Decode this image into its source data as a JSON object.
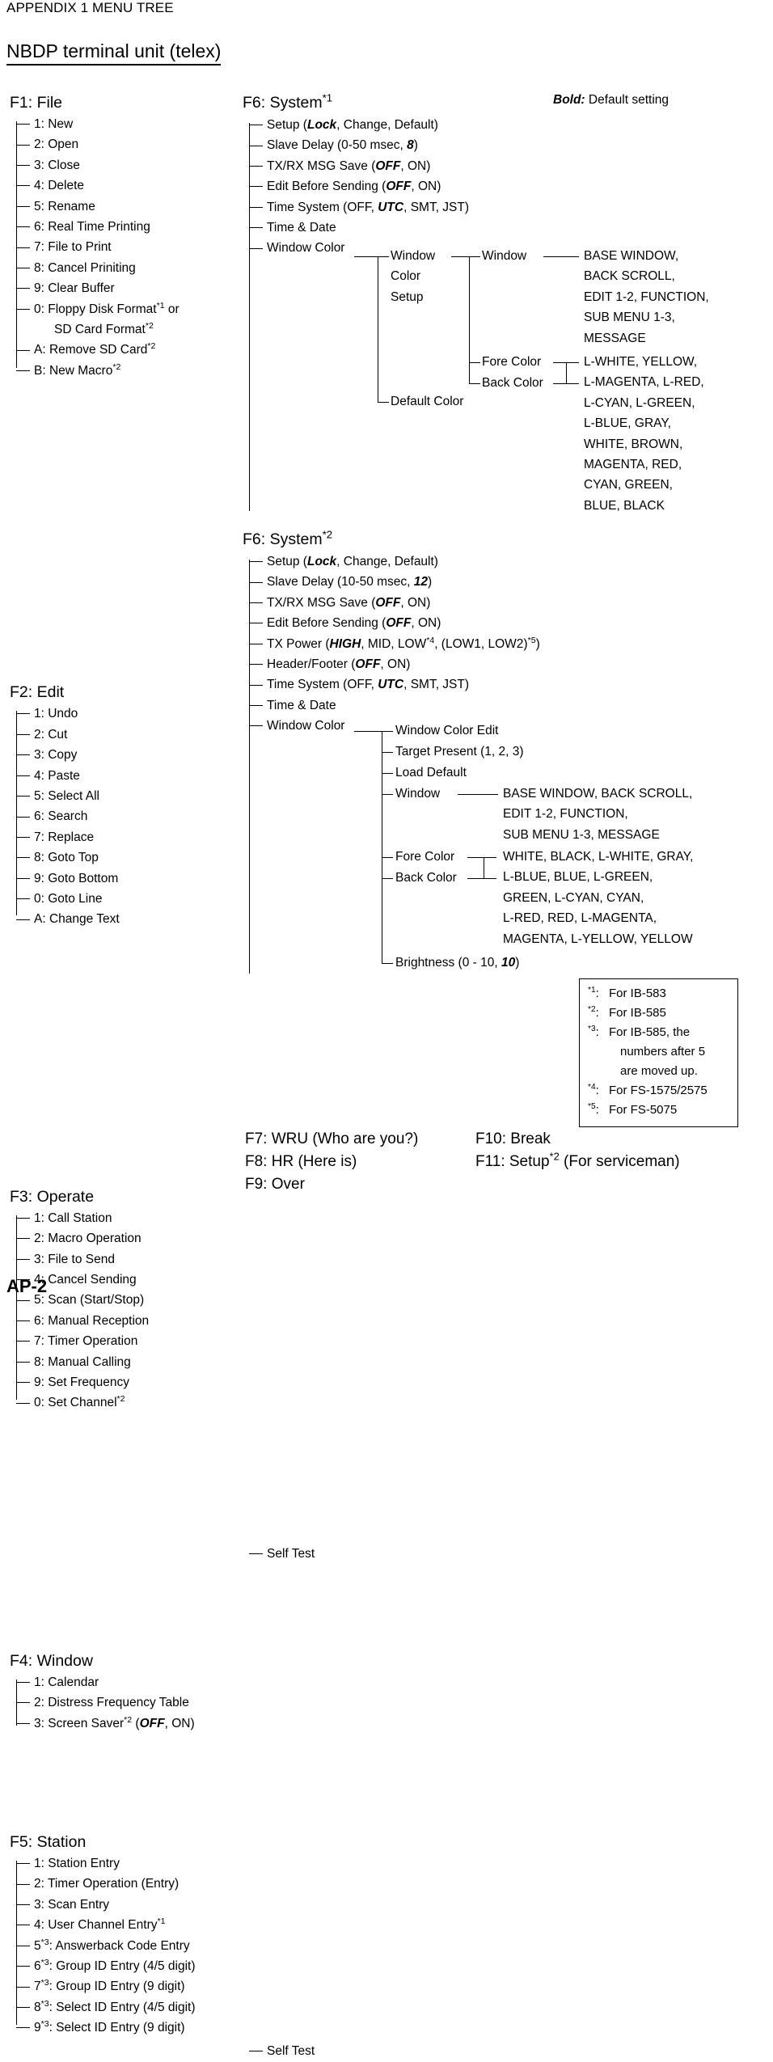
{
  "document": {
    "appendix_title": "APPENDIX 1 MENU TREE",
    "section_title": "NBDP terminal unit (telex)",
    "legend_bold_word": "Bold:",
    "legend_bold_text": " Default setting",
    "page_number": "AP-2"
  },
  "menus": {
    "f1": {
      "title": "F1: File",
      "items": [
        {
          "text": "1: New"
        },
        {
          "text": "2: Open"
        },
        {
          "text": "3: Close"
        },
        {
          "text": "4: Delete"
        },
        {
          "text": "5: Rename"
        },
        {
          "text": "6: Real Time Printing"
        },
        {
          "text": "7: File to Print"
        },
        {
          "text": "8: Cancel Priniting"
        },
        {
          "text": "9: Clear Buffer"
        },
        {
          "text": "0: Floppy Disk Format*1 or"
        },
        {
          "text": "SD Card Format*2",
          "continuation": true
        },
        {
          "text": "A: Remove SD Card*2"
        },
        {
          "text": "B: New Macro*2"
        }
      ]
    },
    "f2": {
      "title": "F2: Edit",
      "items": [
        {
          "text": "1: Undo"
        },
        {
          "text": "2: Cut"
        },
        {
          "text": "3: Copy"
        },
        {
          "text": "4: Paste"
        },
        {
          "text": "5: Select All"
        },
        {
          "text": "6: Search"
        },
        {
          "text": "7: Replace"
        },
        {
          "text": "8: Goto Top"
        },
        {
          "text": "9: Goto Bottom"
        },
        {
          "text": "0: Goto Line"
        },
        {
          "text": "A: Change Text"
        }
      ]
    },
    "f3": {
      "title": "F3: Operate",
      "items": [
        {
          "text": "1: Call Station"
        },
        {
          "text": "2: Macro Operation"
        },
        {
          "text": "3: File to Send"
        },
        {
          "text": "4: Cancel Sending"
        },
        {
          "text": "5: Scan (Start/Stop)"
        },
        {
          "text": "6: Manual Reception"
        },
        {
          "text": "7: Timer Operation"
        },
        {
          "text": "8: Manual Calling"
        },
        {
          "text": "9: Set Frequency"
        },
        {
          "text": "0: Set Channel*2"
        }
      ]
    },
    "f4": {
      "title": "F4: Window",
      "items": [
        {
          "text": "1: Calendar"
        },
        {
          "text": "2: Distress Frequency Table"
        },
        {
          "text": "3: Screen Saver*2 (OFF, ON)"
        }
      ]
    },
    "f5": {
      "title": "F5: Station",
      "items": [
        {
          "text": "1: Station Entry"
        },
        {
          "text": "2: Timer Operation (Entry)"
        },
        {
          "text": "3: Scan Entry"
        },
        {
          "text": "4: User Channel Entry*1"
        },
        {
          "text": "5*3: Answerback Code Entry"
        },
        {
          "text": "6*3: Group ID Entry (4/5 digit)"
        },
        {
          "text": "7*3: Group ID Entry (9 digit)"
        },
        {
          "text": "8*3: Select ID Entry (4/5 digit)"
        },
        {
          "text": "9*3: Select ID Entry (9 digit)"
        }
      ]
    },
    "f6_ib583": {
      "title": "F6: System*1",
      "items": [
        {
          "text": "Setup (Lock, Change, Default)"
        },
        {
          "text": "Slave Delay (0-50 msec, 8)"
        },
        {
          "text": "TX/RX MSG Save (OFF, ON)"
        },
        {
          "text": "Edit Before Sending (OFF, ON)"
        },
        {
          "text": "Time System (OFF, UTC, SMT, JST)"
        },
        {
          "text": "Time & Date"
        },
        {
          "text": "Window Color"
        },
        {
          "text": "Self Test"
        }
      ],
      "window_color_tree": {
        "branch1_line1": "Window",
        "branch1_line2": "Color",
        "branch1_line3": "Setup",
        "branch2": "Default Color",
        "sub": {
          "window": "Window",
          "fore_color": "Fore Color",
          "back_color": "Back Color"
        },
        "window_values": [
          "BASE WINDOW,",
          "BACK SCROLL,",
          "EDIT 1-2, FUNCTION,",
          "SUB MENU 1-3,",
          "MESSAGE"
        ],
        "color_values": [
          "L-WHITE, YELLOW,",
          "L-MAGENTA, L-RED,",
          "L-CYAN, L-GREEN,",
          "L-BLUE, GRAY,",
          "WHITE, BROWN,",
          "MAGENTA, RED,",
          "CYAN, GREEN,",
          "BLUE, BLACK"
        ]
      }
    },
    "f6_ib585": {
      "title": "F6: System*2",
      "items": [
        {
          "text": "Setup (Lock, Change, Default)"
        },
        {
          "text": "Slave Delay (10-50 msec, 12)"
        },
        {
          "text": "TX/RX MSG Save (OFF, ON)"
        },
        {
          "text": "Edit Before Sending (OFF, ON)"
        },
        {
          "text": "TX Power (HIGH, MID, LOW*4, (LOW1, LOW2)*5)"
        },
        {
          "text": "Header/Footer (OFF, ON)"
        },
        {
          "text": "Time System (OFF, UTC, SMT, JST)"
        },
        {
          "text": "Time & Date"
        },
        {
          "text": "Window Color"
        },
        {
          "text": "Self Test"
        }
      ],
      "window_color_tree": {
        "sub": {
          "window_color_edit": "Window Color Edit",
          "target_present": "Target Present (1, 2, 3)",
          "load_default": "Load Default",
          "window": "Window",
          "fore_color": "Fore Color",
          "back_color": "Back Color",
          "brightness": "Brightness (0 - 10, 10)"
        },
        "window_values": [
          "BASE WINDOW, BACK SCROLL,",
          "EDIT 1-2, FUNCTION,",
          "SUB MENU 1-3, MESSAGE"
        ],
        "color_values": [
          "WHITE, BLACK, L-WHITE, GRAY,",
          "L-BLUE, BLUE, L-GREEN,",
          "GREEN, L-CYAN, CYAN,",
          "L-RED, RED, L-MAGENTA,",
          "MAGENTA, L-YELLOW, YELLOW"
        ]
      }
    }
  },
  "function_keys": {
    "left_column": [
      "F7: WRU (Who are you?)",
      "F8: HR (Here is)",
      "F9: Over"
    ],
    "right_column": [
      "F10: Break",
      "F11: Setup*2 (For serviceman)"
    ]
  },
  "footnotes": [
    {
      "marker": "*1:",
      "text": "For IB-583"
    },
    {
      "marker": "*2:",
      "text": "For IB-585"
    },
    {
      "marker": "*3:",
      "text": "For IB-585, the",
      "cont1": "numbers after 5",
      "cont2": "are moved up."
    },
    {
      "marker": "*4:",
      "text": "For FS-1575/2575"
    },
    {
      "marker": "*5:",
      "text": "For FS-5075"
    }
  ]
}
